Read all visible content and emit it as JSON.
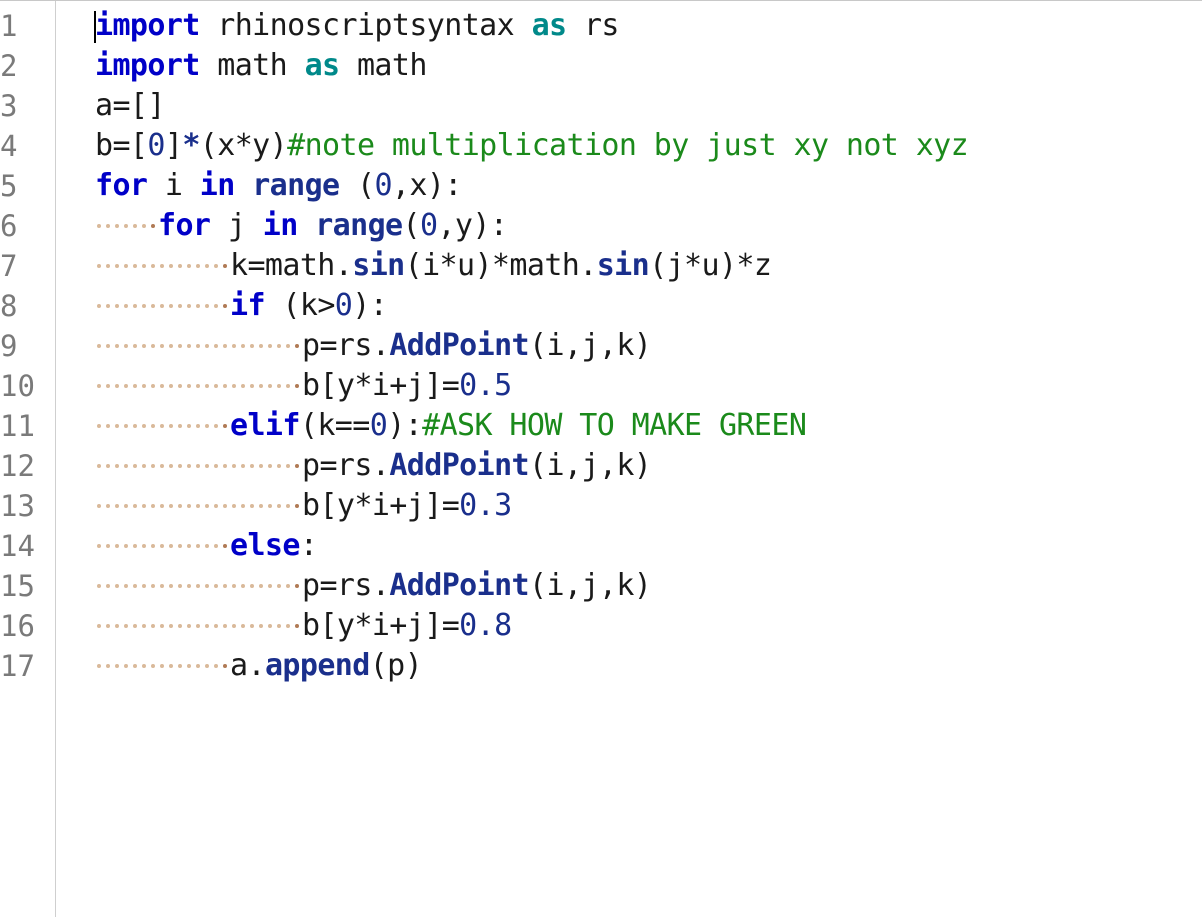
{
  "line_numbers": [
    "1",
    "2",
    "3",
    "4",
    "5",
    "6",
    "7",
    "8",
    "9",
    "10",
    "11",
    "12",
    "13",
    "14",
    "15",
    "16",
    "17"
  ],
  "lines": [
    {
      "indent": 0,
      "tokens": [
        {
          "t": "kw",
          "v": "import"
        },
        {
          "t": "txt",
          "v": " rhinoscriptsyntax "
        },
        {
          "t": "kw2",
          "v": "as"
        },
        {
          "t": "txt",
          "v": " rs"
        }
      ]
    },
    {
      "indent": 0,
      "tokens": [
        {
          "t": "kw",
          "v": "import"
        },
        {
          "t": "txt",
          "v": " math "
        },
        {
          "t": "kw2",
          "v": "as"
        },
        {
          "t": "txt",
          "v": " math"
        }
      ]
    },
    {
      "indent": 0,
      "tokens": [
        {
          "t": "txt",
          "v": "a=[]"
        }
      ]
    },
    {
      "indent": 0,
      "tokens": [
        {
          "t": "txt",
          "v": "b=["
        },
        {
          "t": "num",
          "v": "0"
        },
        {
          "t": "txt",
          "v": "]"
        },
        {
          "t": "fn",
          "v": "*"
        },
        {
          "t": "txt",
          "v": "(x*y)"
        },
        {
          "t": "cmt",
          "v": "#note multiplication by just xy not xyz"
        }
      ]
    },
    {
      "indent": 0,
      "tokens": [
        {
          "t": "kw",
          "v": "for"
        },
        {
          "t": "txt",
          "v": " i "
        },
        {
          "t": "kw",
          "v": "in"
        },
        {
          "t": "txt",
          "v": " "
        },
        {
          "t": "fn",
          "v": "range"
        },
        {
          "t": "txt",
          "v": " ("
        },
        {
          "t": "num",
          "v": "0"
        },
        {
          "t": "txt",
          "v": ",x):"
        }
      ]
    },
    {
      "indent": 4,
      "tokens": [
        {
          "t": "kw",
          "v": "for"
        },
        {
          "t": "txt",
          "v": " j "
        },
        {
          "t": "kw",
          "v": "in"
        },
        {
          "t": "txt",
          "v": " "
        },
        {
          "t": "fn",
          "v": "range"
        },
        {
          "t": "txt",
          "v": "("
        },
        {
          "t": "num",
          "v": "0"
        },
        {
          "t": "txt",
          "v": ",y):"
        }
      ]
    },
    {
      "indent": 8,
      "tokens": [
        {
          "t": "txt",
          "v": "k=math."
        },
        {
          "t": "fn",
          "v": "sin"
        },
        {
          "t": "txt",
          "v": "(i*u)*math."
        },
        {
          "t": "fn",
          "v": "sin"
        },
        {
          "t": "txt",
          "v": "(j*u)*z"
        }
      ]
    },
    {
      "indent": 8,
      "tokens": [
        {
          "t": "kw",
          "v": "if"
        },
        {
          "t": "txt",
          "v": " (k>"
        },
        {
          "t": "num",
          "v": "0"
        },
        {
          "t": "txt",
          "v": "):"
        }
      ]
    },
    {
      "indent": 12,
      "tokens": [
        {
          "t": "txt",
          "v": "p=rs."
        },
        {
          "t": "fn",
          "v": "AddPoint"
        },
        {
          "t": "txt",
          "v": "(i,j,k)"
        }
      ]
    },
    {
      "indent": 12,
      "tokens": [
        {
          "t": "txt",
          "v": "b[y*i+j]="
        },
        {
          "t": "num",
          "v": "0.5"
        }
      ]
    },
    {
      "indent": 8,
      "tokens": [
        {
          "t": "kw",
          "v": "elif"
        },
        {
          "t": "txt",
          "v": "(k=="
        },
        {
          "t": "num",
          "v": "0"
        },
        {
          "t": "txt",
          "v": "):"
        },
        {
          "t": "cmt",
          "v": "#ASK HOW TO MAKE GREEN"
        }
      ]
    },
    {
      "indent": 12,
      "tokens": [
        {
          "t": "txt",
          "v": "p=rs."
        },
        {
          "t": "fn",
          "v": "AddPoint"
        },
        {
          "t": "txt",
          "v": "(i,j,k)"
        }
      ]
    },
    {
      "indent": 12,
      "tokens": [
        {
          "t": "txt",
          "v": "b[y*i+j]="
        },
        {
          "t": "num",
          "v": "0.3"
        }
      ]
    },
    {
      "indent": 8,
      "tokens": [
        {
          "t": "kw",
          "v": "else"
        },
        {
          "t": "txt",
          "v": ":"
        }
      ]
    },
    {
      "indent": 12,
      "tokens": [
        {
          "t": "txt",
          "v": "p=rs."
        },
        {
          "t": "fn",
          "v": "AddPoint"
        },
        {
          "t": "txt",
          "v": "(i,j,k)"
        }
      ]
    },
    {
      "indent": 12,
      "tokens": [
        {
          "t": "txt",
          "v": "b[y*i+j]="
        },
        {
          "t": "num",
          "v": "0.8"
        }
      ]
    },
    {
      "indent": 8,
      "tokens": [
        {
          "t": "txt",
          "v": "a."
        },
        {
          "t": "fn",
          "v": "append"
        },
        {
          "t": "txt",
          "v": "(p)"
        }
      ]
    }
  ],
  "colors": {
    "keyword": "#0000c8",
    "keyword_as": "#00898a",
    "function": "#1a2f8c",
    "number": "#1a2f8c",
    "comment": "#1b8a1b",
    "text": "#1a1a1a",
    "line_number": "#7a7a7a",
    "whitespace_dot": "#d9b99a"
  }
}
